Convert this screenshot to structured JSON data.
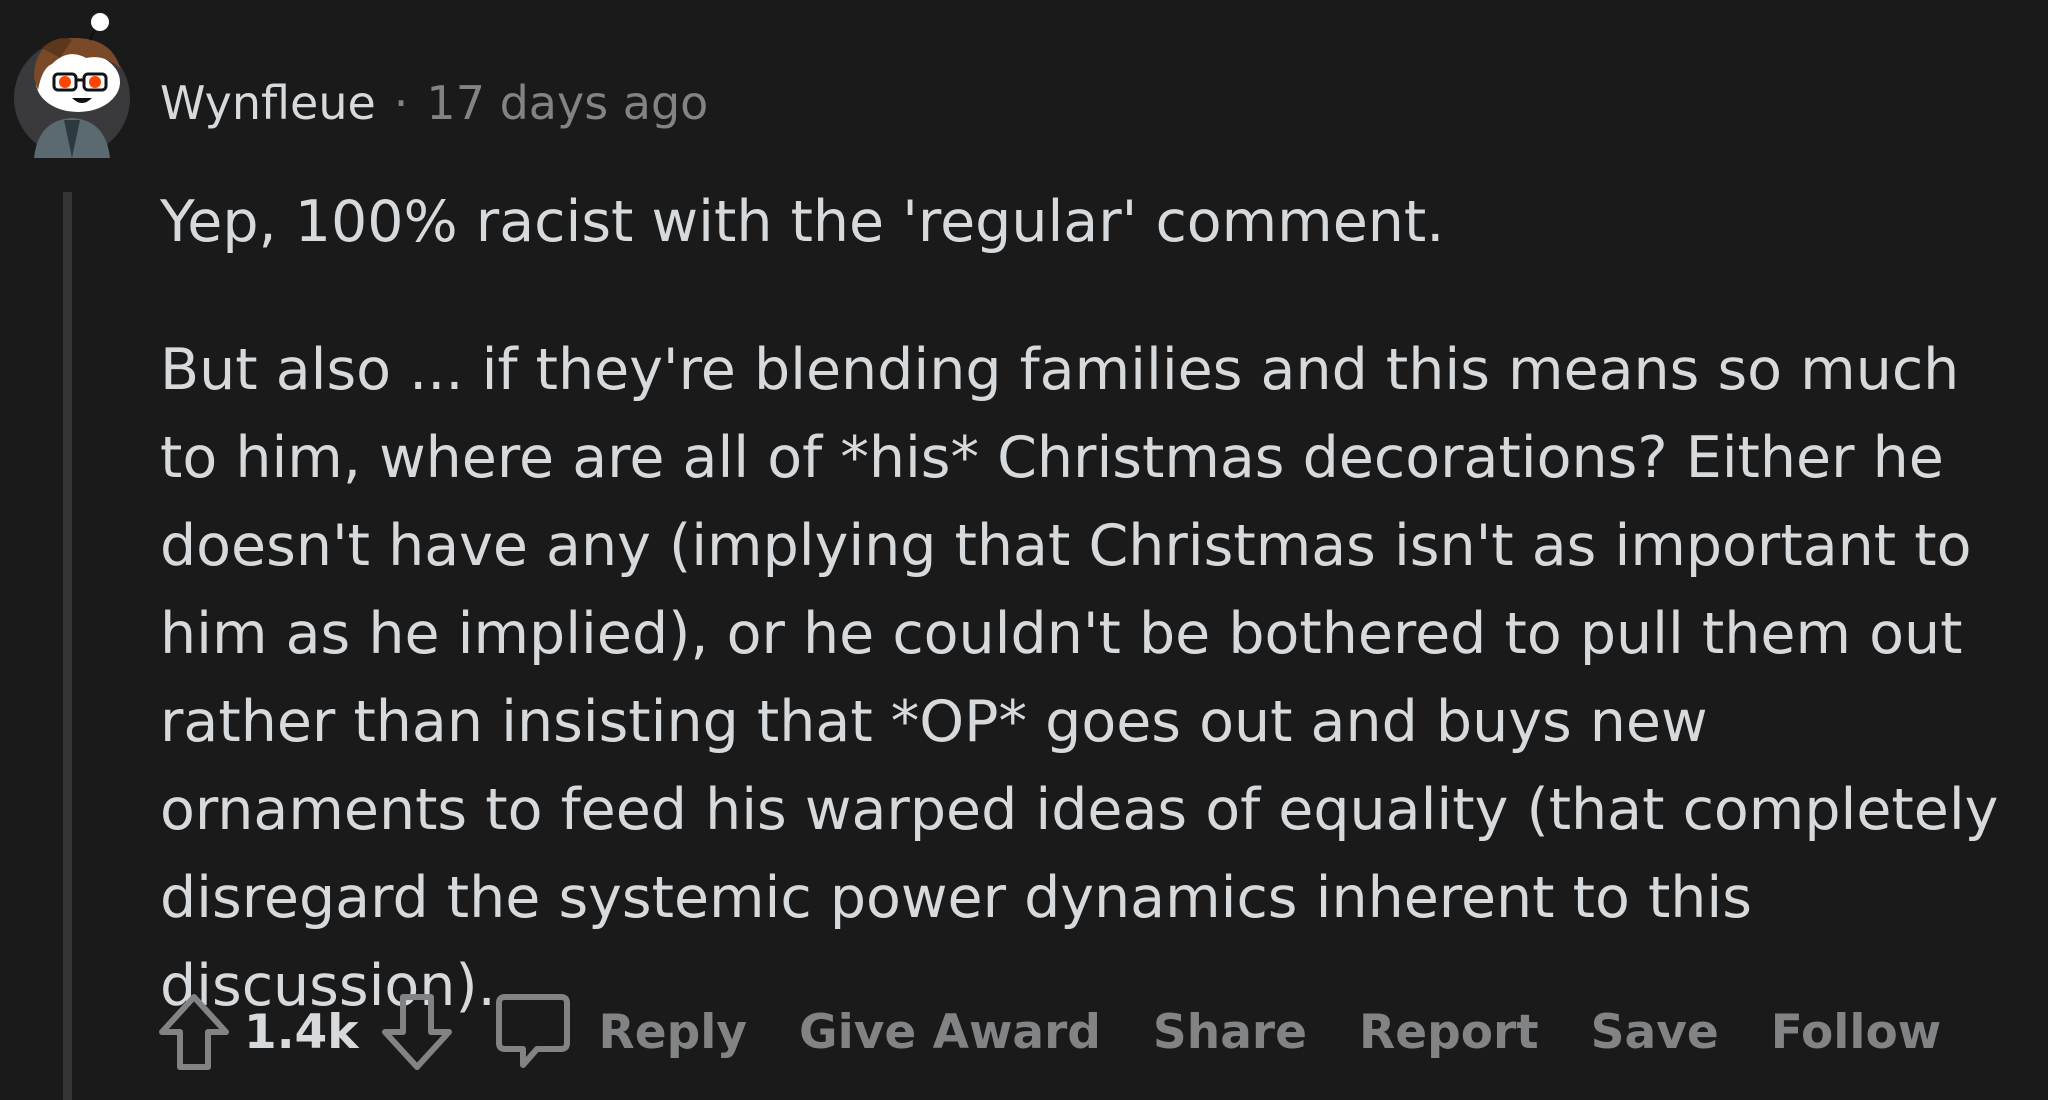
{
  "comment": {
    "author": "Wynfleue",
    "separator": "·",
    "time": "17 days ago",
    "paragraphs": [
      "Yep, 100% racist with the 'regular' comment.",
      "But also ... if they're blending families and this means so much to him, where are all of *his* Christmas decorations? Either he doesn't have any (implying that Christmas isn't as important to him as he implied), or he couldn't be bothered to pull them out rather than insisting that *OP* goes out and buys new ornaments to feed his warped ideas of equality (that completely disregard the systemic power dynamics inherent to this discussion)."
    ],
    "score": "1.4k",
    "actions": {
      "reply": "Reply",
      "give_award": "Give Award",
      "share": "Share",
      "report": "Report",
      "save": "Save",
      "follow": "Follow"
    },
    "icons": {
      "upvote": "upvote-arrow-icon",
      "downvote": "downvote-arrow-icon",
      "reply": "speech-bubble-icon"
    },
    "colors": {
      "background": "#1a1a1b",
      "text": "#d7dadc",
      "muted": "#818384",
      "thread_line": "#343536"
    }
  }
}
